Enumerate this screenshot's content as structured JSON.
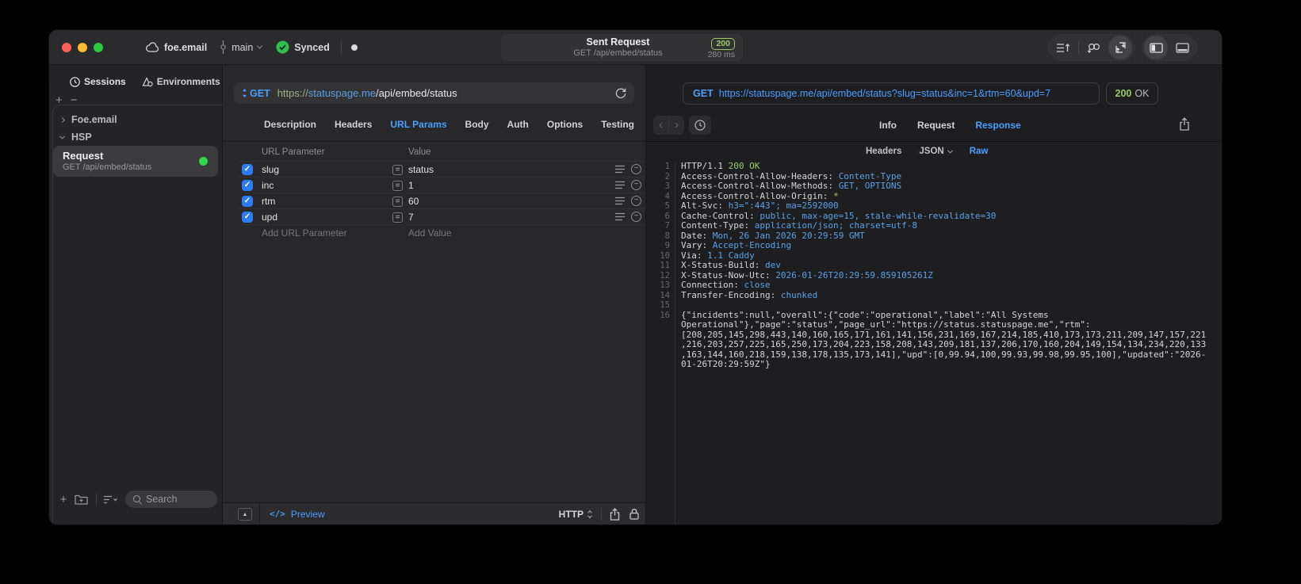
{
  "titlebar": {
    "project": "foe.email",
    "branch": "main",
    "sync_label": "Synced",
    "request": {
      "title": "Sent Request",
      "subtitle": "GET /api/embed/status",
      "status_code": "200",
      "duration": "280 ms"
    }
  },
  "sidebar": {
    "tabs": [
      {
        "label": "Sessions"
      },
      {
        "label": "Environments"
      }
    ],
    "tree": [
      {
        "label": "Foe.email"
      },
      {
        "label": "HSP"
      }
    ],
    "request_item": {
      "title": "Request",
      "subtitle": "GET /api/embed/status"
    },
    "search_placeholder": "Search"
  },
  "request_pane": {
    "method": "GET",
    "url": {
      "scheme": "https://",
      "host": "statuspage.me",
      "path": "/api/embed/status"
    },
    "tabs": [
      "Description",
      "Headers",
      "URL Params",
      "Body",
      "Auth",
      "Options",
      "Testing"
    ],
    "active_tab": "URL Params",
    "params_table": {
      "col_param": "URL Parameter",
      "col_value": "Value",
      "rows": [
        {
          "name": "slug",
          "value": "status"
        },
        {
          "name": "inc",
          "value": "1"
        },
        {
          "name": "rtm",
          "value": "60"
        },
        {
          "name": "upd",
          "value": "7"
        }
      ],
      "add_param": "Add URL Parameter",
      "add_value": "Add Value"
    },
    "footer": {
      "preview": "Preview",
      "protocol": "HTTP"
    }
  },
  "response_pane": {
    "method": "GET",
    "url": "https://statuspage.me/api/embed/status?slug=status&inc=1&rtm=60&upd=7",
    "status_code": "200",
    "status_text": "OK",
    "tabs": [
      "Info",
      "Request",
      "Response"
    ],
    "active_tab": "Response",
    "view_tabs": [
      "Headers",
      "JSON",
      "Raw"
    ],
    "active_view": "Raw",
    "lines": [
      {
        "num": "1",
        "key": "HTTP/1.1 ",
        "value": "200 OK"
      },
      {
        "num": "2",
        "key": "Access-Control-Allow-Headers: ",
        "value": "Content-Type"
      },
      {
        "num": "3",
        "key": "Access-Control-Allow-Methods: ",
        "value": "GET, OPTIONS"
      },
      {
        "num": "4",
        "key": "Access-Control-Allow-Origin: ",
        "value": "*"
      },
      {
        "num": "5",
        "key": "Alt-Svc: ",
        "value": "h3=\":443\"; ma=2592000"
      },
      {
        "num": "6",
        "key": "Cache-Control: ",
        "value": "public, max-age=15, stale-while-revalidate=30"
      },
      {
        "num": "7",
        "key": "Content-Type: ",
        "value": "application/json; charset=utf-8"
      },
      {
        "num": "8",
        "key": "Date: ",
        "value": "Mon, 26 Jan 2026 20:29:59 GMT"
      },
      {
        "num": "9",
        "key": "Vary: ",
        "value": "Accept-Encoding"
      },
      {
        "num": "10",
        "key": "Via: ",
        "value": "1.1 Caddy"
      },
      {
        "num": "11",
        "key": "X-Status-Build: ",
        "value": "dev"
      },
      {
        "num": "12",
        "key": "X-Status-Now-Utc: ",
        "value": "2026-01-26T20:29:59.859105261Z"
      },
      {
        "num": "13",
        "key": "Connection: ",
        "value": "close"
      },
      {
        "num": "14",
        "key": "Transfer-Encoding: ",
        "value": "chunked"
      },
      {
        "num": "15",
        "key": "",
        "value": ""
      },
      {
        "num": "16",
        "body": "{\"incidents\":null,\"overall\":{\"code\":\"operational\",\"label\":\"All Systems Operational\"},\"page\":\"status\",\"page_url\":\"https://status.statuspage.me\",\"rtm\":[208,205,145,298,443,140,160,165,171,161,141,156,231,169,167,214,185,410,173,173,211,209,147,157,221,216,203,257,225,165,250,173,204,223,158,208,143,209,181,137,206,170,160,204,149,154,134,234,220,133,163,144,160,218,159,138,178,135,173,141],\"upd\":[0,99.94,100,99.93,99.98,99.95,100],\"updated\":\"2026-01-26T20:29:59Z\"}"
      }
    ]
  },
  "colors": {
    "accent_blue": "#4a9eff",
    "success_green": "#9acc65",
    "sync_green": "#2fbf4f",
    "checkbox_blue": "#2f7cf7"
  },
  "icons": {
    "plus": "+",
    "minus": "−",
    "equals": "=",
    "collapse": "▲",
    "check": "✓",
    "back": "‹",
    "forward": "›",
    "code": "</>"
  }
}
